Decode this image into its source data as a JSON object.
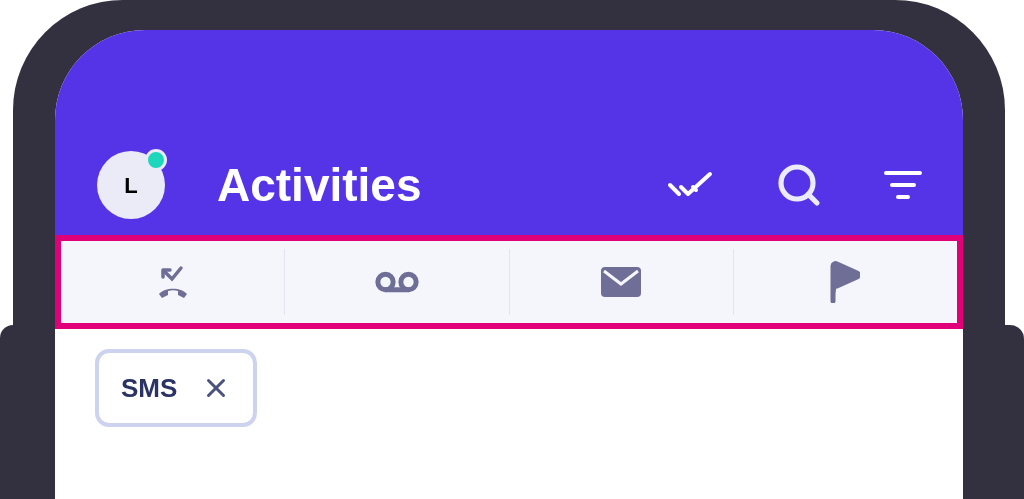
{
  "header": {
    "avatar": {
      "initial": "L",
      "online": true
    },
    "title": "Activities"
  },
  "tab_bar": {
    "highlighted": true,
    "tabs": [
      {
        "kind": "missed-call"
      },
      {
        "kind": "voicemail"
      },
      {
        "kind": "mail"
      },
      {
        "kind": "flag"
      }
    ]
  },
  "filters": [
    {
      "label": "SMS"
    }
  ]
}
